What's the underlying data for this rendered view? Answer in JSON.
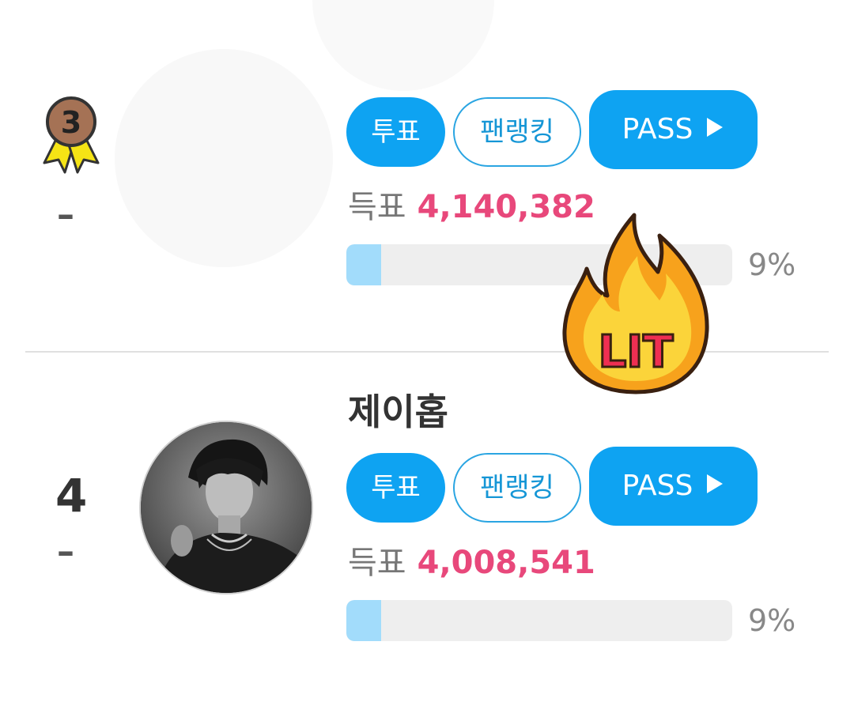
{
  "entries": [
    {
      "rank_badge_number": "3",
      "rank_change": "–",
      "name": "",
      "buttons": {
        "vote": "투표",
        "fanranking": "팬랭킹",
        "pass": "PASS"
      },
      "votes_label": "득표",
      "votes_value": "4,140,382",
      "progress_fraction": 0.09,
      "percent_text": "9%"
    },
    {
      "rank": "4",
      "rank_change": "–",
      "name": "제이홉",
      "buttons": {
        "vote": "투표",
        "fanranking": "팬랭킹",
        "pass": "PASS"
      },
      "votes_label": "득표",
      "votes_value": "4,008,541",
      "progress_fraction": 0.09,
      "percent_text": "9%"
    }
  ],
  "sticker": {
    "text": "LIT"
  },
  "colors": {
    "accent_blue": "#0ea3f2",
    "vote_pink": "#e8487b",
    "progress_fill": "#a2dcfb",
    "medal_bronze": "#a57255",
    "ribbon_yellow": "#f5e415"
  },
  "icons": {
    "rank_badge": "bronze-medal-icon",
    "pass_arrow": "play-triangle-icon",
    "sticker": "fire-lit-sticker"
  }
}
